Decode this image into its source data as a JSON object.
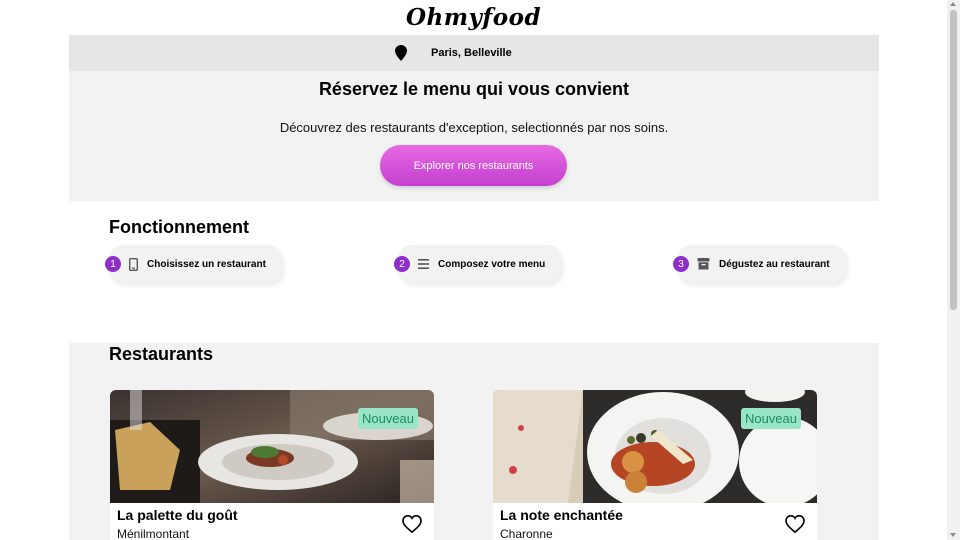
{
  "header": {
    "logo": "Ohmyfood"
  },
  "location": {
    "text": "Paris, Belleville"
  },
  "hero": {
    "title": "Réservez le menu qui vous convient",
    "subtitle": "Découvrez des restaurants d'exception, selectionnés par nos soins.",
    "cta_label": "Explorer nos restaurants"
  },
  "how_it_works": {
    "title": "Fonctionnement",
    "steps": [
      {
        "number": "1",
        "icon": "phone-icon",
        "label": "Choisissez un restaurant"
      },
      {
        "number": "2",
        "icon": "list-icon",
        "label": "Composez votre menu"
      },
      {
        "number": "3",
        "icon": "store-icon",
        "label": "Dégustez au restaurant"
      }
    ]
  },
  "restaurants": {
    "title": "Restaurants",
    "items": [
      {
        "name": "La palette du goût",
        "area": "Ménilmontant",
        "badge": "Nouveau"
      },
      {
        "name": "La note enchantée",
        "area": "Charonne",
        "badge": "Nouveau"
      }
    ]
  },
  "colors": {
    "accent": "#9356dc",
    "cta": "#d44fd6",
    "badge_bg": "#99e5c8",
    "badge_text": "#1f8c5a"
  }
}
